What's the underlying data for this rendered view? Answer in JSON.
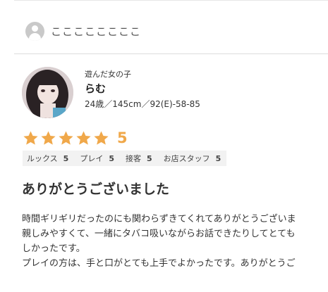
{
  "reviewer": {
    "name": "ここここここここ"
  },
  "girl": {
    "label": "遊んだ女の子",
    "name": "らむ",
    "spec": "24歳／145cm／92(E)-58-85"
  },
  "rating": {
    "stars": 5,
    "max_stars": 5,
    "score_text": "5",
    "star_color": "#f0a84a"
  },
  "subratings": [
    {
      "label": "ルックス",
      "value": "5"
    },
    {
      "label": "プレイ",
      "value": "5"
    },
    {
      "label": "接客",
      "value": "5"
    },
    {
      "label": "お店スタッフ",
      "value": "5"
    }
  ],
  "review": {
    "title": "ありがとうございました",
    "lines": [
      "時間ギリギリだったのにも関わらずきてくれてありがとうございま",
      "親しみやすくて、一緒にタバコ吸いながらお話できたりしてとても",
      "しかったです。",
      "プレイの方は、手と口がとても上手でよかったです。ありがとうご"
    ]
  }
}
